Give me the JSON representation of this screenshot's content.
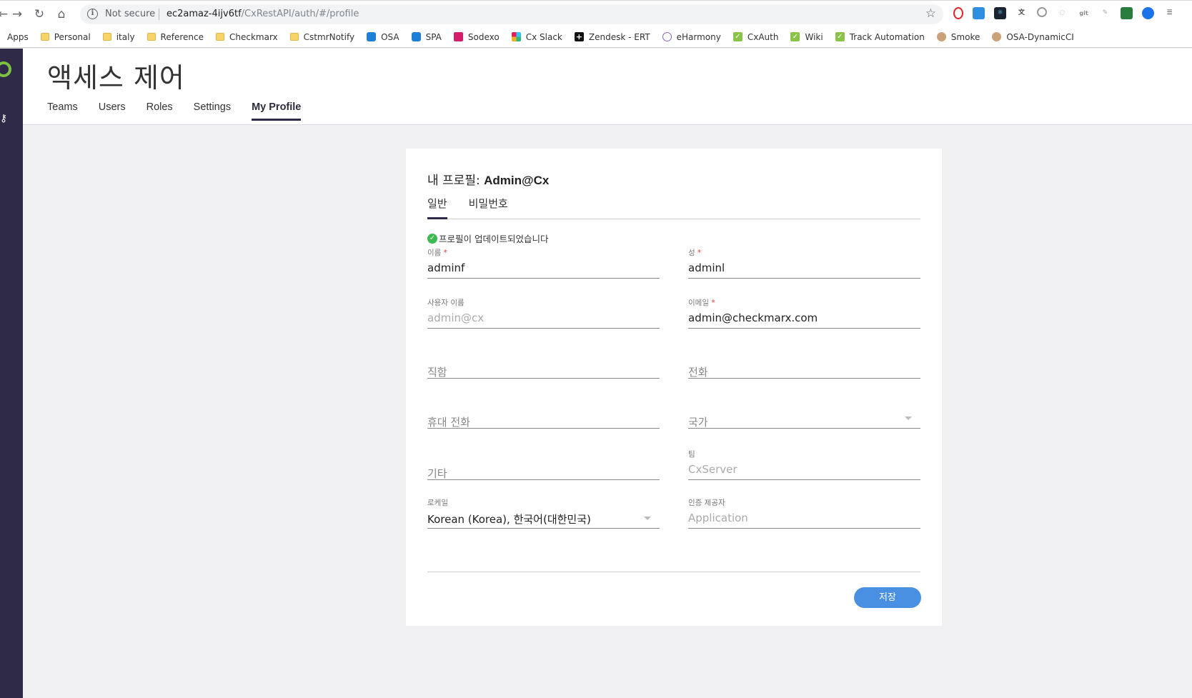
{
  "browser": {
    "security_label": "Not secure",
    "url_host": "ec2amaz-4ijv6tf",
    "url_path": "/CxRestAPI/auth/#/profile"
  },
  "bookmarks": [
    {
      "label": "Apps",
      "icon": "apps-icon"
    },
    {
      "label": "Personal",
      "icon": "folder-icon"
    },
    {
      "label": "italy",
      "icon": "folder-icon"
    },
    {
      "label": "Reference",
      "icon": "folder-icon"
    },
    {
      "label": "Checkmarx",
      "icon": "folder-icon"
    },
    {
      "label": "CstmrNotify",
      "icon": "folder-icon"
    },
    {
      "label": "OSA",
      "icon": "osa-icon"
    },
    {
      "label": "SPA",
      "icon": "osa-icon"
    },
    {
      "label": "Sodexo",
      "icon": "sodexo-icon"
    },
    {
      "label": "Cx Slack",
      "icon": "slack-icon"
    },
    {
      "label": "Zendesk - ERT",
      "icon": "zendesk-icon"
    },
    {
      "label": "eHarmony",
      "icon": "eharmony-icon"
    },
    {
      "label": "CxAuth",
      "icon": "check-icon"
    },
    {
      "label": "Wiki",
      "icon": "check-icon"
    },
    {
      "label": "Track Automation",
      "icon": "check-icon"
    },
    {
      "label": "Smoke",
      "icon": "person-icon"
    },
    {
      "label": "OSA-DynamicCI",
      "icon": "person-icon"
    }
  ],
  "header": {
    "title": "액세스 제어",
    "tabs": [
      "Teams",
      "Users",
      "Roles",
      "Settings",
      "My Profile"
    ],
    "active_tab": "My Profile"
  },
  "profile": {
    "title_prefix": "내 프로필: ",
    "title_user": "Admin@Cx",
    "tabs": [
      "일반",
      "비밀번호"
    ],
    "status": "프로필이 업데이트되었습니다",
    "first_name": {
      "label": "이름",
      "value": "adminf"
    },
    "last_name": {
      "label": "성",
      "value": "adminl"
    },
    "username": {
      "label": "사용자 이름",
      "value": "admin@cx"
    },
    "email": {
      "label": "이메일",
      "value": "admin@checkmarx.com"
    },
    "job_title": {
      "placeholder": "직함"
    },
    "phone": {
      "placeholder": "전화"
    },
    "mobile": {
      "placeholder": "휴대 전화"
    },
    "country": {
      "placeholder": "국가"
    },
    "other": {
      "placeholder": "기타"
    },
    "team": {
      "label": "팀",
      "value": "CxServer"
    },
    "locale": {
      "label": "로케일",
      "value": "Korean (Korea), 한국어(대한민국)"
    },
    "auth_provider": {
      "label": "인증 제공자",
      "value": "Application"
    },
    "required_mark": "*",
    "save_label": "저장"
  },
  "colors": {
    "rail": "#2f2a48",
    "accent": "#4a90e2",
    "success": "#3dbb52"
  }
}
